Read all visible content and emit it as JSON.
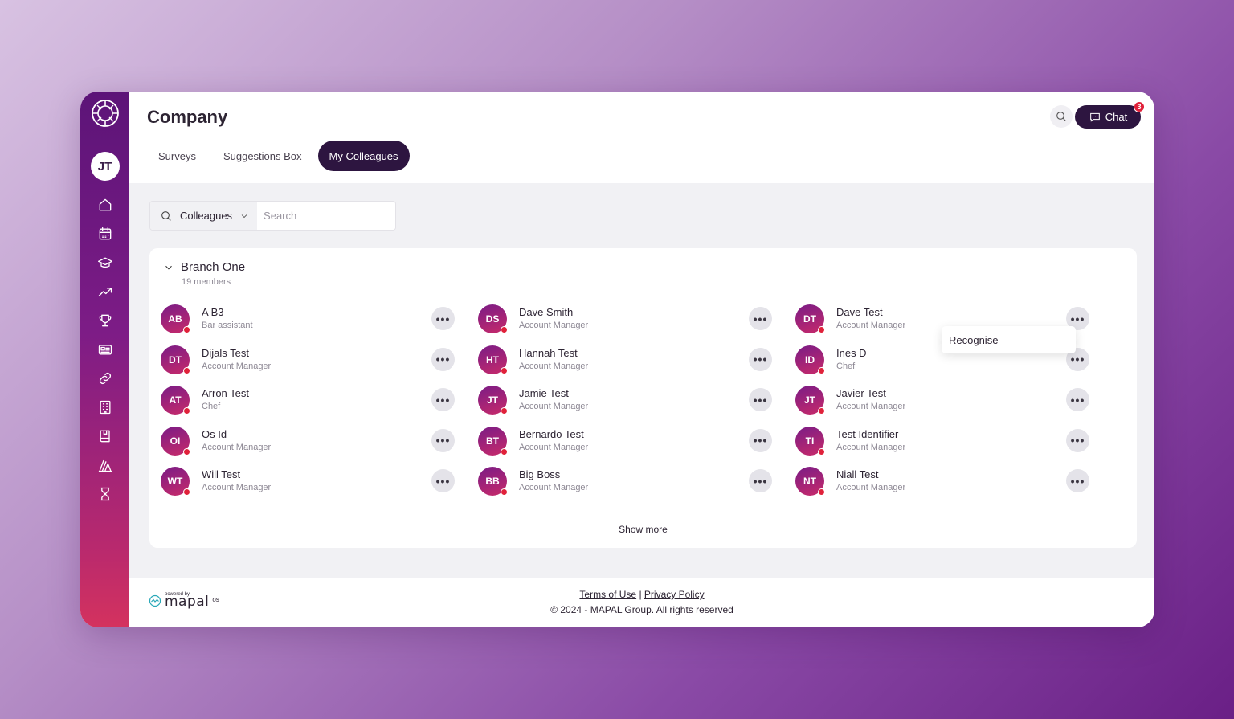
{
  "sidebar": {
    "user_initials": "JT",
    "nav_icons": [
      "home-icon",
      "calendar-icon",
      "graduation-cap-icon",
      "trending-up-icon",
      "trophy-icon",
      "news-icon",
      "link-icon",
      "building-icon",
      "book-icon",
      "chart-pen-icon",
      "hourglass-icon"
    ]
  },
  "header": {
    "title": "Company",
    "tabs": [
      {
        "label": "Surveys",
        "active": false
      },
      {
        "label": "Suggestions Box",
        "active": false
      },
      {
        "label": "My Colleagues",
        "active": true
      }
    ],
    "chat_label": "Chat",
    "chat_badge": "3"
  },
  "filter": {
    "select_value": "Colleagues",
    "search_placeholder": "Search"
  },
  "branch": {
    "name": "Branch One",
    "count": "19 members",
    "show_more": "Show more"
  },
  "colleagues": [
    {
      "initials": "AB",
      "name": "A B3",
      "role": "Bar assistant"
    },
    {
      "initials": "DS",
      "name": "Dave Smith",
      "role": "Account Manager"
    },
    {
      "initials": "DT",
      "name": "Dave Test",
      "role": "Account Manager"
    },
    {
      "initials": "DT",
      "name": "Dijals Test",
      "role": "Account Manager"
    },
    {
      "initials": "HT",
      "name": "Hannah Test",
      "role": "Account Manager"
    },
    {
      "initials": "ID",
      "name": "Ines D",
      "role": "Chef"
    },
    {
      "initials": "AT",
      "name": "Arron Test",
      "role": "Chef"
    },
    {
      "initials": "JT",
      "name": "Jamie Test",
      "role": "Account Manager"
    },
    {
      "initials": "JT",
      "name": "Javier Test",
      "role": "Account Manager"
    },
    {
      "initials": "OI",
      "name": "Os Id",
      "role": "Account Manager"
    },
    {
      "initials": "BT",
      "name": "Bernardo Test",
      "role": "Account Manager"
    },
    {
      "initials": "TI",
      "name": "Test Identifier",
      "role": "Account Manager"
    },
    {
      "initials": "WT",
      "name": "Will Test",
      "role": "Account Manager"
    },
    {
      "initials": "BB",
      "name": "Big Boss",
      "role": "Account Manager"
    },
    {
      "initials": "NT",
      "name": "Niall Test",
      "role": "Account Manager"
    }
  ],
  "more_glyph": "•••",
  "popup": {
    "label": "Recognise"
  },
  "footer": {
    "powered_by": "powered by",
    "brand": "mapal",
    "brand_sup": "os",
    "terms": "Terms of Use",
    "separator": "|",
    "privacy": "Privacy Policy",
    "copyright": "© 2024 - MAPAL Group. All rights reserved"
  },
  "colors": {
    "sidebar_top": "#5c1478",
    "sidebar_bottom": "#d4325e",
    "accent_dark": "#2d1540",
    "status_red": "#e0213a"
  }
}
